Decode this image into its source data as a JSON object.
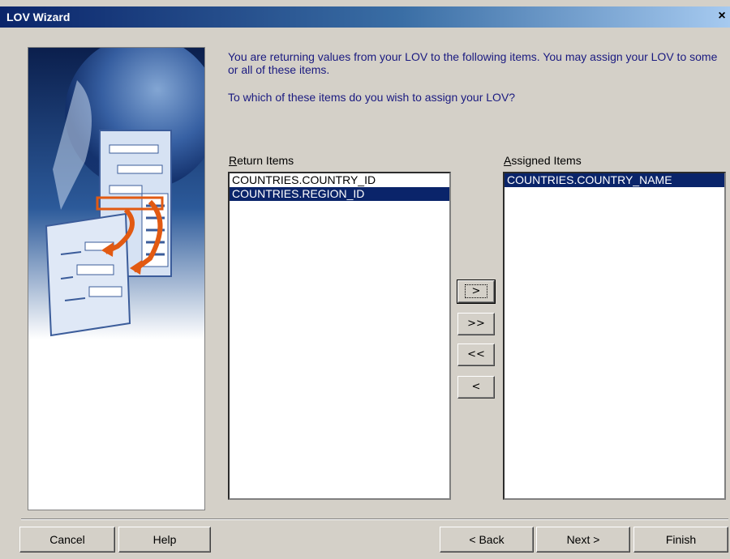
{
  "window": {
    "title": "LOV Wizard",
    "close_glyph": "×"
  },
  "instructions": {
    "line1": "You are returning values from your LOV to the following items. You may assign your LOV to some or all of these items.",
    "line2": "To which of these items do you wish to assign your LOV?"
  },
  "return_items": {
    "label_first": "R",
    "label_rest": "eturn Items",
    "items": [
      "COUNTRIES.COUNTRY_ID",
      "COUNTRIES.REGION_ID"
    ],
    "selected_index": 1
  },
  "assigned_items": {
    "label_first": "A",
    "label_rest": "ssigned Items",
    "items": [
      "COUNTRIES.COUNTRY_NAME"
    ],
    "selected_index": 0
  },
  "move_buttons": {
    "add": ">",
    "add_all": ">>",
    "remove_all": "<<",
    "remove": "<"
  },
  "footer": {
    "cancel": "Cancel",
    "help": "Help",
    "back": "< Back",
    "next": "Next >",
    "finish": "Finish"
  },
  "icons": {
    "art": "wizard-illustration-icon",
    "close": "close-icon"
  }
}
